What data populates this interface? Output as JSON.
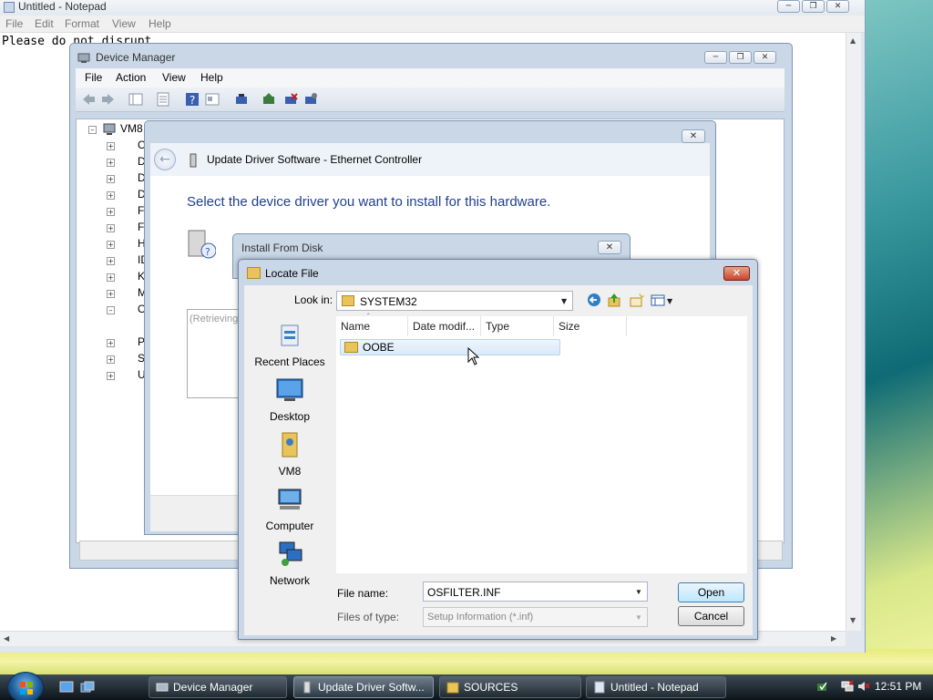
{
  "notepad": {
    "title": "Untitled - Notepad",
    "menu": [
      "File",
      "Edit",
      "Format",
      "View",
      "Help"
    ],
    "content": "Please do not disrupt"
  },
  "device_manager": {
    "title": "Device Manager",
    "menu": [
      "File",
      "Action",
      "View",
      "Help"
    ],
    "tree_root": "VM8",
    "tree_letters": [
      "C",
      "D",
      "D",
      "D",
      "F",
      "F",
      "H",
      "ID",
      "K",
      "M",
      "O",
      "P",
      "S",
      "U"
    ]
  },
  "wizard": {
    "title": "Update Driver Software - Ethernet Controller",
    "heading": "Select the device driver you want to install for this hardware.",
    "list_text": "(Retrieving"
  },
  "install_from_disk": {
    "title": "Install From Disk"
  },
  "locate_file": {
    "title": "Locate File",
    "look_in_label": "Look in:",
    "look_in_value": "SYSTEM32",
    "places": [
      "Recent Places",
      "Desktop",
      "VM8",
      "Computer",
      "Network"
    ],
    "columns": [
      "Name",
      "Date modif...",
      "Type",
      "Size"
    ],
    "files": [
      {
        "name": "OOBE"
      }
    ],
    "file_name_label": "File name:",
    "file_name_value": "OSFILTER.INF",
    "files_of_type_label": "Files of type:",
    "files_of_type_value": "Setup Information (*.inf)",
    "open_button": "Open",
    "cancel_button": "Cancel"
  },
  "taskbar": {
    "buttons": [
      "Device Manager",
      "Update Driver Softw...",
      "SOURCES",
      "Untitled - Notepad"
    ],
    "clock": "12:51 PM"
  },
  "colors": {
    "heading_blue": "#1f3f8f",
    "close_red": "#c8452b",
    "folder": "#e8c45a"
  }
}
